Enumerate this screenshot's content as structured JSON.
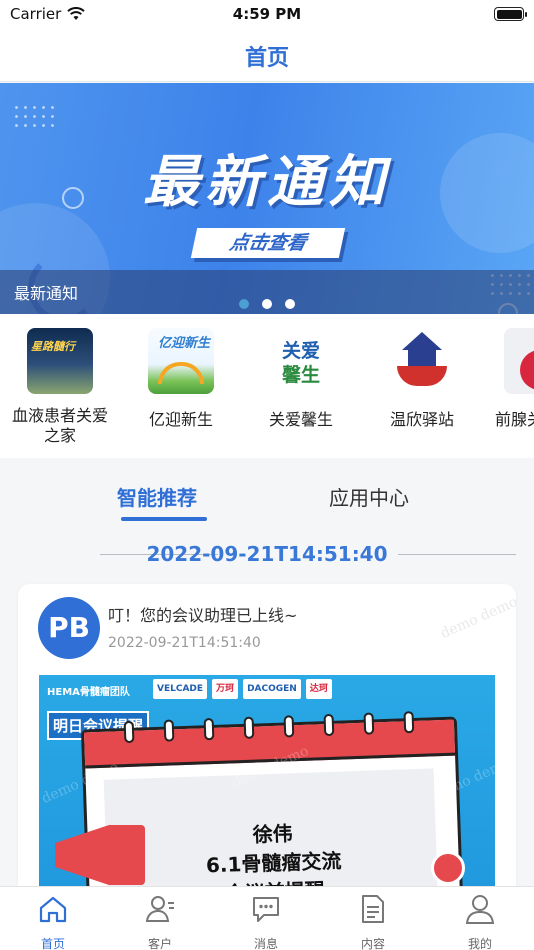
{
  "status_bar": {
    "carrier": "Carrier",
    "time": "4:59 PM"
  },
  "nav": {
    "title": "首页"
  },
  "banner": {
    "title": "最新通知",
    "button": "点击查看",
    "caption": "最新通知",
    "pages": 3,
    "active_page": 1
  },
  "services": [
    {
      "label": "血液患者关爱之家",
      "icon": "blood-care-icon"
    },
    {
      "label": "亿迎新生",
      "icon": "yi-ying-icon"
    },
    {
      "label": "关爱馨生",
      "icon": "guan-ai-icon"
    },
    {
      "label": "温欣驿站",
      "icon": "house-icon"
    },
    {
      "label": "前腺关",
      "icon": "prostate-icon"
    }
  ],
  "service_icon_text": {
    "blood": "星路髓行",
    "yi": "亿迎新生",
    "care_line1": "关爱",
    "care_line2": "馨生"
  },
  "tabs": {
    "smart": "智能推荐",
    "apps": "应用中心",
    "active": "smart"
  },
  "feed": {
    "date": "2022-09-21T14:51:40",
    "card": {
      "avatar": "PB",
      "title": "叮！您的会议助理已上线~",
      "time": "2022-09-21T14:51:40",
      "watermark": "demo demo",
      "poster": {
        "org": "HEMA骨髓瘤团队",
        "logos": [
          "VELCADE",
          "万珂",
          "DACOGEN",
          "达珂"
        ],
        "tag": "明日会议提醒",
        "name": "徐伟",
        "line2": "6.1骨髓瘤交流",
        "line3": "会议前提醒"
      }
    }
  },
  "tabbar": [
    {
      "label": "首页",
      "icon": "home-icon",
      "active": true
    },
    {
      "label": "客户",
      "icon": "customer-icon",
      "active": false
    },
    {
      "label": "消息",
      "icon": "message-icon",
      "active": false
    },
    {
      "label": "内容",
      "icon": "document-icon",
      "active": false
    },
    {
      "label": "我的",
      "icon": "profile-icon",
      "active": false
    }
  ],
  "colors": {
    "accent": "#2f6fd6",
    "banner": "#4a8fec",
    "poster_red": "#e5484d"
  }
}
